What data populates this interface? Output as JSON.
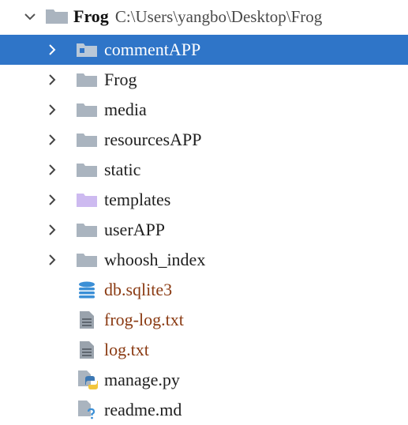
{
  "root": {
    "name": "Frog",
    "path": "C:\\Users\\yangbo\\Desktop\\Frog",
    "icon": "folder-icon",
    "expanded": true
  },
  "items": [
    {
      "label": "commentAPP",
      "type": "folder",
      "icon": "folder-icon",
      "selected": true
    },
    {
      "label": "Frog",
      "type": "folder",
      "icon": "folder-icon"
    },
    {
      "label": "media",
      "type": "folder",
      "icon": "folder-icon"
    },
    {
      "label": "resourcesAPP",
      "type": "folder",
      "icon": "folder-icon"
    },
    {
      "label": "static",
      "type": "folder",
      "icon": "folder-icon"
    },
    {
      "label": "templates",
      "type": "folder",
      "icon": "templates-folder-icon"
    },
    {
      "label": "userAPP",
      "type": "folder",
      "icon": "folder-icon"
    },
    {
      "label": "whoosh_index",
      "type": "folder",
      "icon": "folder-icon"
    },
    {
      "label": "db.sqlite3",
      "type": "file",
      "icon": "database-icon"
    },
    {
      "label": "frog-log.txt",
      "type": "file",
      "icon": "text-file-icon"
    },
    {
      "label": "log.txt",
      "type": "file",
      "icon": "text-file-icon"
    },
    {
      "label": "manage.py",
      "type": "file",
      "icon": "python-file-icon"
    },
    {
      "label": "readme.md",
      "type": "file",
      "icon": "markdown-file-icon"
    }
  ],
  "colors": {
    "selection": "#2f75c8",
    "folder": "#aab4bf",
    "templates_folder": "#cdbaf0",
    "untracked_text": "#8a3a12",
    "database": "#3b8fd6"
  }
}
